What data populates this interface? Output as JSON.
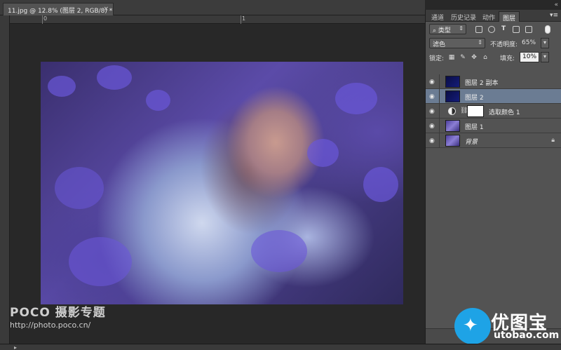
{
  "document": {
    "tab_title": "11.jpg @ 12.8% (图层 2, RGB/8) *",
    "close_glyph": "×"
  },
  "rulers": {
    "top_labels": [
      "0",
      "1"
    ]
  },
  "watermark": {
    "brand": "POCO 摄影专题",
    "url": "http://photo.poco.cn/"
  },
  "panel": {
    "tabs": [
      "通道",
      "历史记录",
      "动作",
      "图层"
    ],
    "active_tab": "图层",
    "collapse_glyph": "«",
    "menu_glyph": "▾≡",
    "filter": {
      "kind_label": "类型",
      "icons": [
        "image-filter-icon",
        "adjustment-filter-icon",
        "type-filter-icon",
        "shape-filter-icon",
        "smart-object-filter-icon"
      ]
    },
    "blend_mode": "滤色",
    "opacity_label": "不透明度:",
    "opacity_value": "65%",
    "lock_label": "锁定:",
    "fill_label": "填充:",
    "fill_value": "10%",
    "layers": [
      {
        "name": "图层 2 副本",
        "thumb": "dark",
        "selected": false
      },
      {
        "name": "图层 2",
        "thumb": "dark",
        "selected": true
      },
      {
        "name": "选取颜色 1",
        "thumb": "adjustment",
        "selected": false
      },
      {
        "name": "图层 1",
        "thumb": "image",
        "selected": false
      },
      {
        "name": "背景",
        "thumb": "image",
        "selected": false,
        "locked": true
      }
    ]
  },
  "logo": {
    "cn": "优图宝",
    "url": "utobao.com"
  },
  "colors": {
    "panel_bg": "#535353",
    "selected_layer": "#6b7c93",
    "logo_blue": "#1ea3e6"
  }
}
